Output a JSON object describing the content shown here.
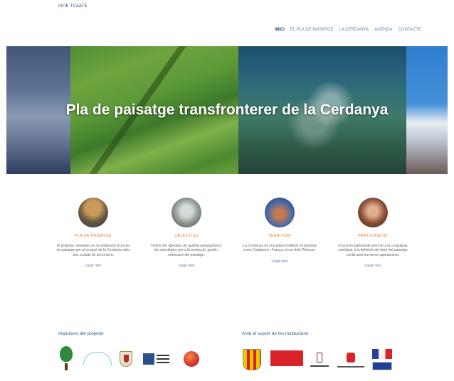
{
  "header": {
    "logo_text": "ІАПЕ ТСААТЕ"
  },
  "nav": {
    "items": [
      {
        "label": "INICI",
        "active": true
      },
      {
        "label": "EL PLA DE PAISATGE",
        "active": false
      },
      {
        "label": "LA CERDANYA",
        "active": false
      },
      {
        "label": "AGENDA",
        "active": false
      },
      {
        "label": "CONTACTE",
        "active": false
      }
    ]
  },
  "hero": {
    "title": "Pla de paisatge transfronterer de la Cerdanya"
  },
  "features": [
    {
      "title": "PLA DE PAISATGE",
      "text": "El projecte consisteix en la realització d'un pla de paisatge per al conjunt de la Cerdanya dels dos costats de la frontera.",
      "more": "Llegir més"
    },
    {
      "title": "OBJECTIUS",
      "text": "Definir els objectius de qualitat paisatgística i les estratègies per a la protecció, gestió i ordenació del paisatge.",
      "more": "Llegir més"
    },
    {
      "title": "TERRITORI",
      "text": "La Cerdanya és una plana d'altitud compartida entre Catalunya i França, al cor dels Pirineus.",
      "more": "Llegir més"
    },
    {
      "title": "PARTICIPACIÓ",
      "text": "El procés participatiu permet a la ciutadania contribuir a la definició del futur del paisatge cerdà amb les seves aportacions.",
      "more": "Llegir més"
    }
  ],
  "partners": {
    "left_title": "Impulsors del projecte",
    "right_title": "Amb el suport de les institucions",
    "left_logos": [
      "tree-logo",
      "wave-logo",
      "shield-logo",
      "box-logo",
      "apple-logo"
    ],
    "right_logos": [
      "catalonia-shield-logo",
      "red-banner-logo",
      "municipal-logo",
      "red-mark-logo",
      "eu-flag-logo"
    ]
  }
}
